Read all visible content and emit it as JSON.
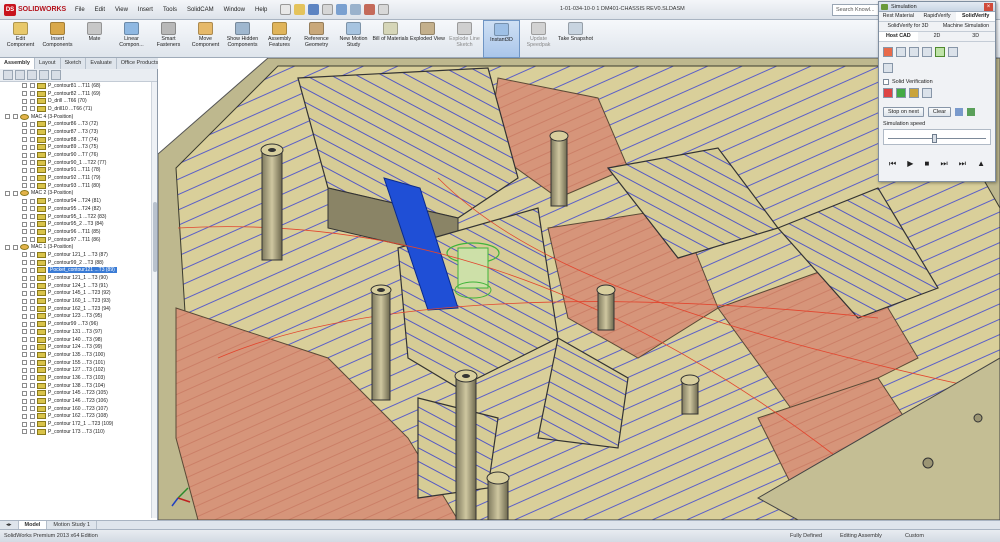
{
  "app": {
    "logo": "SOLIDWORKS",
    "document_title": "1-01-034-10-0 1 DM401-CHASSIS REV0.SLDASM",
    "search_placeholder": "Search Knowl..."
  },
  "menu": [
    "File",
    "Edit",
    "View",
    "Insert",
    "Tools",
    "SolidCAM",
    "Window",
    "Help"
  ],
  "commands": [
    {
      "label": "Edit Component",
      "color": "#e8c86a"
    },
    {
      "label": "Insert Components",
      "color": "#d9a84a"
    },
    {
      "label": "Mate",
      "color": "#c7c7c7"
    },
    {
      "label": "Linear Compon...",
      "color": "#8fb8e2"
    },
    {
      "label": "Smart Fasteners",
      "color": "#b8b8b8"
    },
    {
      "label": "Move Component",
      "color": "#e6b96a"
    },
    {
      "label": "Show Hidden Components",
      "color": "#9fb7cf"
    },
    {
      "label": "Assembly Features",
      "color": "#e0b45a"
    },
    {
      "label": "Reference Geometry",
      "color": "#c9a87a"
    },
    {
      "label": "New Motion Study",
      "color": "#a7c4e0"
    },
    {
      "label": "Bill of Materials",
      "color": "#d6d6b8"
    },
    {
      "label": "Exploded View",
      "color": "#c4b08c"
    },
    {
      "label": "Explode Line Sketch",
      "color": "#cfcfcf"
    },
    {
      "label": "Instant3D",
      "color": "#9ec0e6"
    },
    {
      "label": "Update Speedpak",
      "color": "#d2d2d2"
    },
    {
      "label": "Take Snapshot",
      "color": "#c8d4e0"
    }
  ],
  "command_tabs": [
    "Assembly",
    "Layout",
    "Sketch",
    "Evaluate",
    "Office Products",
    "SolidCAM Part"
  ],
  "tree": [
    {
      "label": "P_contour81 ...T11 (68)",
      "kind": "op"
    },
    {
      "label": "P_contour82 ...T11 (69)",
      "kind": "op"
    },
    {
      "label": "D_drill ...T66 (70)",
      "kind": "op"
    },
    {
      "label": "D_drill10 ...T66 (71)",
      "kind": "op"
    },
    {
      "label": "MAC 4 (3-Position)",
      "kind": "mac"
    },
    {
      "label": "P_contour86 ...T3 (72)",
      "kind": "op"
    },
    {
      "label": "P_contour87 ...T3 (73)",
      "kind": "op"
    },
    {
      "label": "P_contour88 ...T7 (74)",
      "kind": "op"
    },
    {
      "label": "P_contour89 ...T3 (75)",
      "kind": "op"
    },
    {
      "label": "P_contour90 ...T7 (76)",
      "kind": "op"
    },
    {
      "label": "P_contour90_1 ...T22 (77)",
      "kind": "op"
    },
    {
      "label": "P_contour91 ...T11 (78)",
      "kind": "op"
    },
    {
      "label": "P_contour92 ...T11 (79)",
      "kind": "op"
    },
    {
      "label": "P_contour93 ...T11 (80)",
      "kind": "op"
    },
    {
      "label": "MAC 2 (3-Position)",
      "kind": "mac"
    },
    {
      "label": "P_contour94 ...T24 (81)",
      "kind": "op"
    },
    {
      "label": "P_contour95 ...T24 (82)",
      "kind": "op"
    },
    {
      "label": "P_contour95_1 ...T22 (83)",
      "kind": "op"
    },
    {
      "label": "P_contour95_2 ...T3 (84)",
      "kind": "op"
    },
    {
      "label": "P_contour96 ...T11 (85)",
      "kind": "op"
    },
    {
      "label": "P_contour97 ...T11 (86)",
      "kind": "op"
    },
    {
      "label": "MAC 1 (3-Position)",
      "kind": "mac"
    },
    {
      "label": "P_contour 121_1 ...T3 (87)",
      "kind": "op"
    },
    {
      "label": "P_contour99_2 ...T3 (88)",
      "kind": "op"
    },
    {
      "label": "Pocket_contour121 ...T3 (89)",
      "kind": "op",
      "hl": true
    },
    {
      "label": "P_contour 121_1 ...T3 (90)",
      "kind": "op"
    },
    {
      "label": "P_contour 124_1 ...T3 (91)",
      "kind": "op"
    },
    {
      "label": "P_contour 145_1 ...T23 (92)",
      "kind": "op"
    },
    {
      "label": "P_contour 160_1 ...T23 (93)",
      "kind": "op"
    },
    {
      "label": "P_contour 162_1 ...T23 (94)",
      "kind": "op"
    },
    {
      "label": "P_contour 123 ...T3 (95)",
      "kind": "op"
    },
    {
      "label": "P_contour99 ...T3 (96)",
      "kind": "op"
    },
    {
      "label": "P_contour 131 ...T3 (97)",
      "kind": "op"
    },
    {
      "label": "P_contour 140 ...T3 (98)",
      "kind": "op"
    },
    {
      "label": "P_contour 124 ...T3 (99)",
      "kind": "op"
    },
    {
      "label": "P_contour 135 ...T3 (100)",
      "kind": "op"
    },
    {
      "label": "P_contour 155 ...T3 (101)",
      "kind": "op"
    },
    {
      "label": "P_contour 127 ...T3 (102)",
      "kind": "op"
    },
    {
      "label": "P_contour 136 ...T3 (103)",
      "kind": "op"
    },
    {
      "label": "P_contour 138 ...T3 (104)",
      "kind": "op"
    },
    {
      "label": "P_contour 145 ...T23 (105)",
      "kind": "op"
    },
    {
      "label": "P_contour 146 ...T23 (106)",
      "kind": "op"
    },
    {
      "label": "P_contour 160 ...T23 (107)",
      "kind": "op"
    },
    {
      "label": "P_contour 162 ...T23 (108)",
      "kind": "op"
    },
    {
      "label": "P_contour 172_1 ...T23 (109)",
      "kind": "op"
    },
    {
      "label": "P_contour 173 ...T3 (110)",
      "kind": "op"
    }
  ],
  "bottom_tabs": [
    "Model",
    "Motion Study 1"
  ],
  "status": {
    "edition": "SolidWorks Premium 2013 x64 Edition",
    "defined": "Fully Defined",
    "mode": "Editing Assembly",
    "units": "Custom"
  },
  "simulation": {
    "title": "Simulation",
    "tabs_row1": [
      "Rest Material",
      "RapidVerify",
      "SolidVerify"
    ],
    "tabs_row2": [
      "SolidVerify for 3D",
      "Machine Simulation"
    ],
    "tabs_row3": [
      "Host CAD",
      "2D",
      "3D"
    ],
    "solid_verification": "Solid Verification",
    "stop_on_next": "Stop on next",
    "clear": "Clear",
    "speed_label": "Simulation speed"
  }
}
